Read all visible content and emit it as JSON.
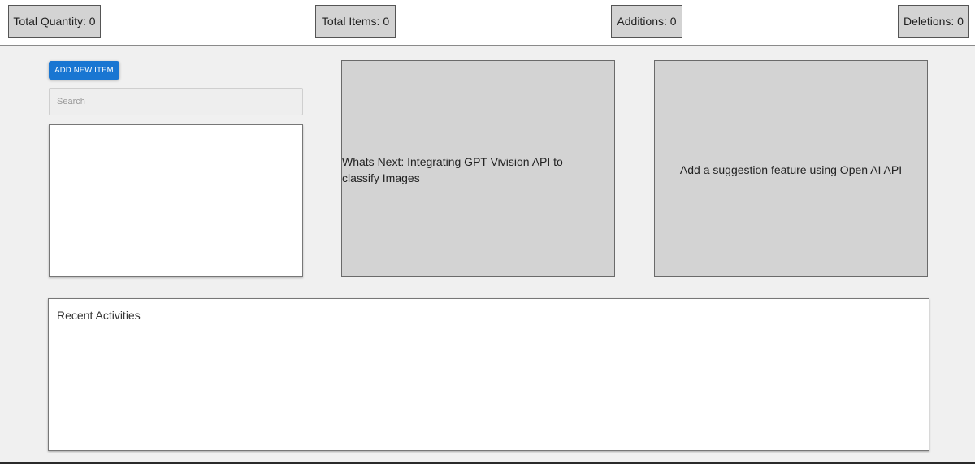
{
  "stats": {
    "total_quantity": "Total Quantity: 0",
    "total_items": "Total Items: 0",
    "additions": "Additions: 0",
    "deletions": "Deletions: 0"
  },
  "inventory": {
    "add_button_label": "ADD NEW ITEM",
    "search_placeholder": "Search",
    "search_value": "",
    "items": []
  },
  "cards": {
    "whats_next": "Whats Next: Integrating GPT Vivision API to classify Images",
    "suggestion": "Add a suggestion feature using Open AI API"
  },
  "activities": {
    "title": "Recent Activities",
    "entries": []
  },
  "colors": {
    "accent_button": "#1976d2",
    "stat_box_bg": "#d3d3d3",
    "card_bg": "#d3d3d3",
    "page_bg": "#f0f0f0"
  }
}
